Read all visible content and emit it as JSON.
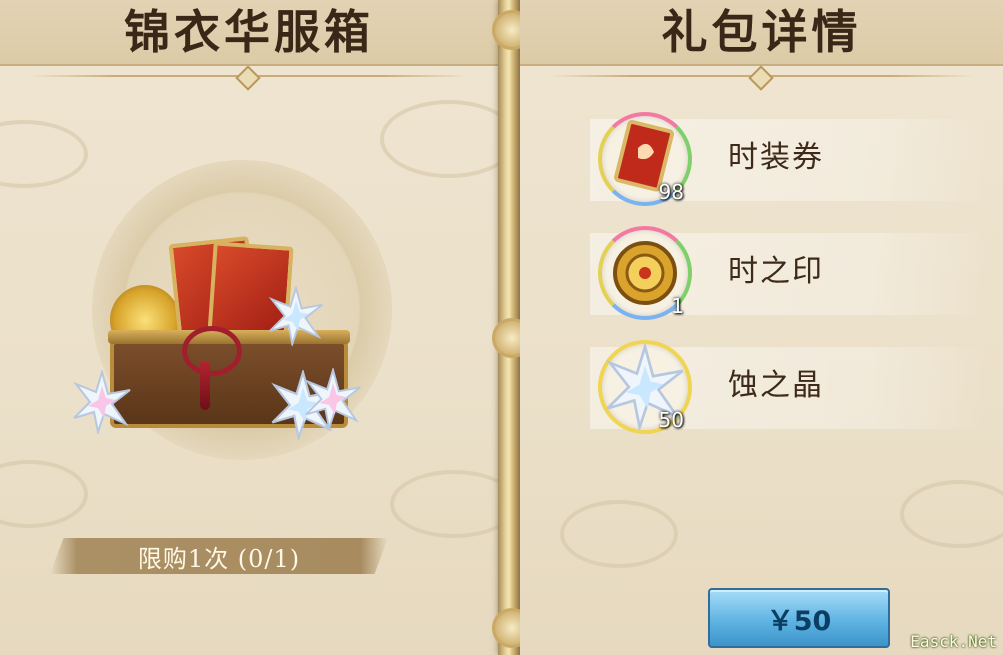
{
  "left_panel": {
    "title": "锦衣华服箱",
    "purchase_limit": "限购1次 (0/1)"
  },
  "right_panel": {
    "title": "礼包详情",
    "rewards": [
      {
        "name": "时装券",
        "count": "98",
        "icon": "fashion-ticket-icon"
      },
      {
        "name": "时之印",
        "count": "1",
        "icon": "time-seal-icon"
      },
      {
        "name": "蚀之晶",
        "count": "50",
        "icon": "crystal-icon"
      }
    ]
  },
  "price_button": {
    "label": "￥50"
  },
  "watermark": "Easck.Net",
  "colors": {
    "panel_bg": "#ebe0c9",
    "title_text": "#3a2717",
    "price_button": "#5fb4e3"
  }
}
